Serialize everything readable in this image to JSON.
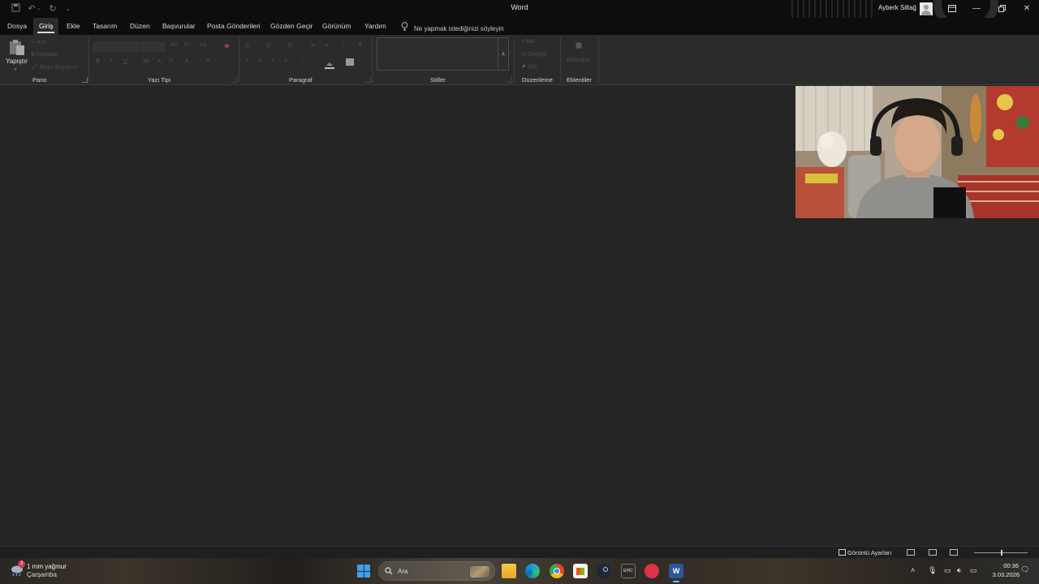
{
  "window": {
    "title": "Word",
    "user_name": "Ayberk Siltağ"
  },
  "menu": {
    "tabs": [
      "Dosya",
      "Giriş",
      "Ekle",
      "Tasarım",
      "Düzen",
      "Başvurular",
      "Posta Gönderileri",
      "Gözden Geçir",
      "Görünüm",
      "Yardım"
    ],
    "active_tab": "Giriş",
    "tell_me": "Ne yapmak istediğinizi söyleyin"
  },
  "ribbon": {
    "clipboard": {
      "paste_label": "Yapıştır",
      "cut_label": "Kes",
      "copy_label": "Kopyala",
      "format_painter_label": "Biçim Boyacısı",
      "group_label": "Pano"
    },
    "font": {
      "group_label": "Yazı Tipi"
    },
    "paragraph": {
      "group_label": "Paragraf"
    },
    "styles": {
      "group_label": "Stiller"
    },
    "editing": {
      "find_label": "Bul",
      "replace_label": "Değiştir",
      "select_label": "Seç",
      "group_label": "Düzenleme"
    },
    "addins": {
      "button_label": "Eklentiler",
      "group_label": "Eklentiler"
    }
  },
  "statusbar": {
    "display_settings": "Görüntü Ayarları"
  },
  "taskbar": {
    "weather_badge": "3",
    "weather_text": "1 mm yağmur",
    "weather_day": "Çarşamba",
    "search_placeholder": "Ara",
    "apps": [
      "file-explorer",
      "edge",
      "chrome",
      "microsoft-store",
      "steam",
      "epic-games",
      "app-red",
      "word"
    ],
    "clock_time": "00:36",
    "clock_date": "3.03.2026"
  },
  "colors": {
    "app_bg": "#262626",
    "titlebar_bg": "#0d0d0d",
    "ribbon_bg": "#2b2b2b",
    "accent_word": "#2b579a",
    "start_blue": "#3aa0f0"
  }
}
